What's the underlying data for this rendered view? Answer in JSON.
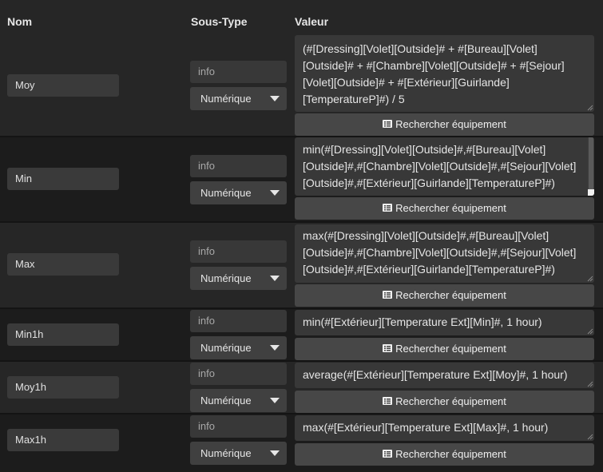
{
  "headers": {
    "nom": "Nom",
    "sous_type": "Sous-Type",
    "valeur": "Valeur"
  },
  "search_button_label": "Rechercher équipement",
  "rows": [
    {
      "name": "Moy",
      "type": "info",
      "subtype": "Numérique",
      "value": "(#[Dressing][Volet][Outside]# + #[Bureau][Volet][Outside]# + #[Chambre][Volet][Outside]# + #[Sejour][Volet][Outside]# + #[Extérieur][Guirlande][TemperatureP]#) / 5"
    },
    {
      "name": "Min",
      "type": "info",
      "subtype": "Numérique",
      "value": "min(#[Dressing][Volet][Outside]#,#[Bureau][Volet][Outside]#,#[Chambre][Volet][Outside]#,#[Sejour][Volet][Outside]#,#[Extérieur][Guirlande][TemperatureP]#)"
    },
    {
      "name": "Max",
      "type": "info",
      "subtype": "Numérique",
      "value": "max(#[Dressing][Volet][Outside]#,#[Bureau][Volet][Outside]#,#[Chambre][Volet][Outside]#,#[Sejour][Volet][Outside]#,#[Extérieur][Guirlande][TemperatureP]#)"
    },
    {
      "name": "Min1h",
      "type": "info",
      "subtype": "Numérique",
      "value": "min(#[Extérieur][Temperature Ext][Min]#, 1 hour)"
    },
    {
      "name": "Moy1h",
      "type": "info",
      "subtype": "Numérique",
      "value": "average(#[Extérieur][Temperature Ext][Moy]#, 1 hour)"
    },
    {
      "name": "Max1h",
      "type": "info",
      "subtype": "Numérique",
      "value": "max(#[Extérieur][Temperature Ext][Max]#, 1 hour)"
    }
  ]
}
